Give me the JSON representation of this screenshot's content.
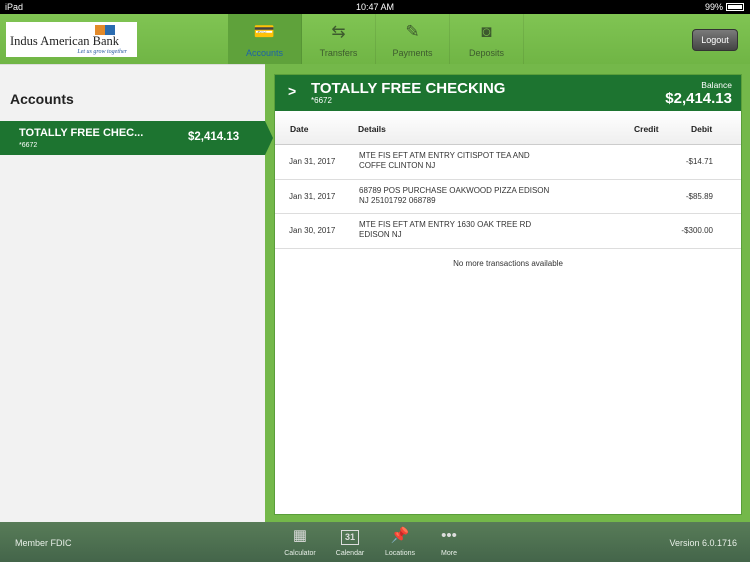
{
  "status_bar": {
    "device": "iPad",
    "time": "10:47 AM",
    "battery": "99%"
  },
  "header": {
    "logo_name": "Indus American Bank",
    "logo_tagline": "Let us grow together",
    "tabs": [
      {
        "label": "Accounts",
        "icon": "credit-card-icon",
        "selected": true
      },
      {
        "label": "Transfers",
        "icon": "transfer-arrows-icon"
      },
      {
        "label": "Payments",
        "icon": "check-pen-icon"
      },
      {
        "label": "Deposits",
        "icon": "camera-icon"
      }
    ],
    "logout": "Logout"
  },
  "sidebar": {
    "title": "Accounts",
    "accounts": [
      {
        "name": "TOTALLY FREE CHEC...",
        "number": "*6672",
        "balance": "$2,414.13"
      }
    ]
  },
  "account": {
    "title": "TOTALLY FREE CHECKING",
    "number": "*6672",
    "balance_label": "Balance",
    "balance": "$2,414.13",
    "columns": [
      "Date",
      "Details",
      "Credit",
      "Debit"
    ],
    "transactions": [
      {
        "date": "Jan 31, 2017",
        "details": "MTE FIS EFT ATM ENTRY CITISPOT TEA AND COFFE CLINTON NJ",
        "credit": "",
        "debit": "-$14.71"
      },
      {
        "date": "Jan 31, 2017",
        "details": "68789 POS PURCHASE OAKWOOD PIZZA EDISON NJ 25101792 068789",
        "credit": "",
        "debit": "-$85.89"
      },
      {
        "date": "Jan 30, 2017",
        "details": "MTE FIS EFT ATM ENTRY 1630 OAK TREE RD EDISON NJ",
        "credit": "",
        "debit": "-$300.00"
      }
    ],
    "footer": "No more transactions available"
  },
  "bottom": {
    "fdic": "Member FDIC",
    "version": "Version 6.0.1716",
    "tools": [
      {
        "label": "Calculator",
        "icon": "calculator-icon"
      },
      {
        "label": "Calendar",
        "icon": "calendar-icon",
        "glyph": "31"
      },
      {
        "label": "Locations",
        "icon": "pushpin-icon"
      },
      {
        "label": "More",
        "icon": "more-dots-icon"
      }
    ]
  }
}
